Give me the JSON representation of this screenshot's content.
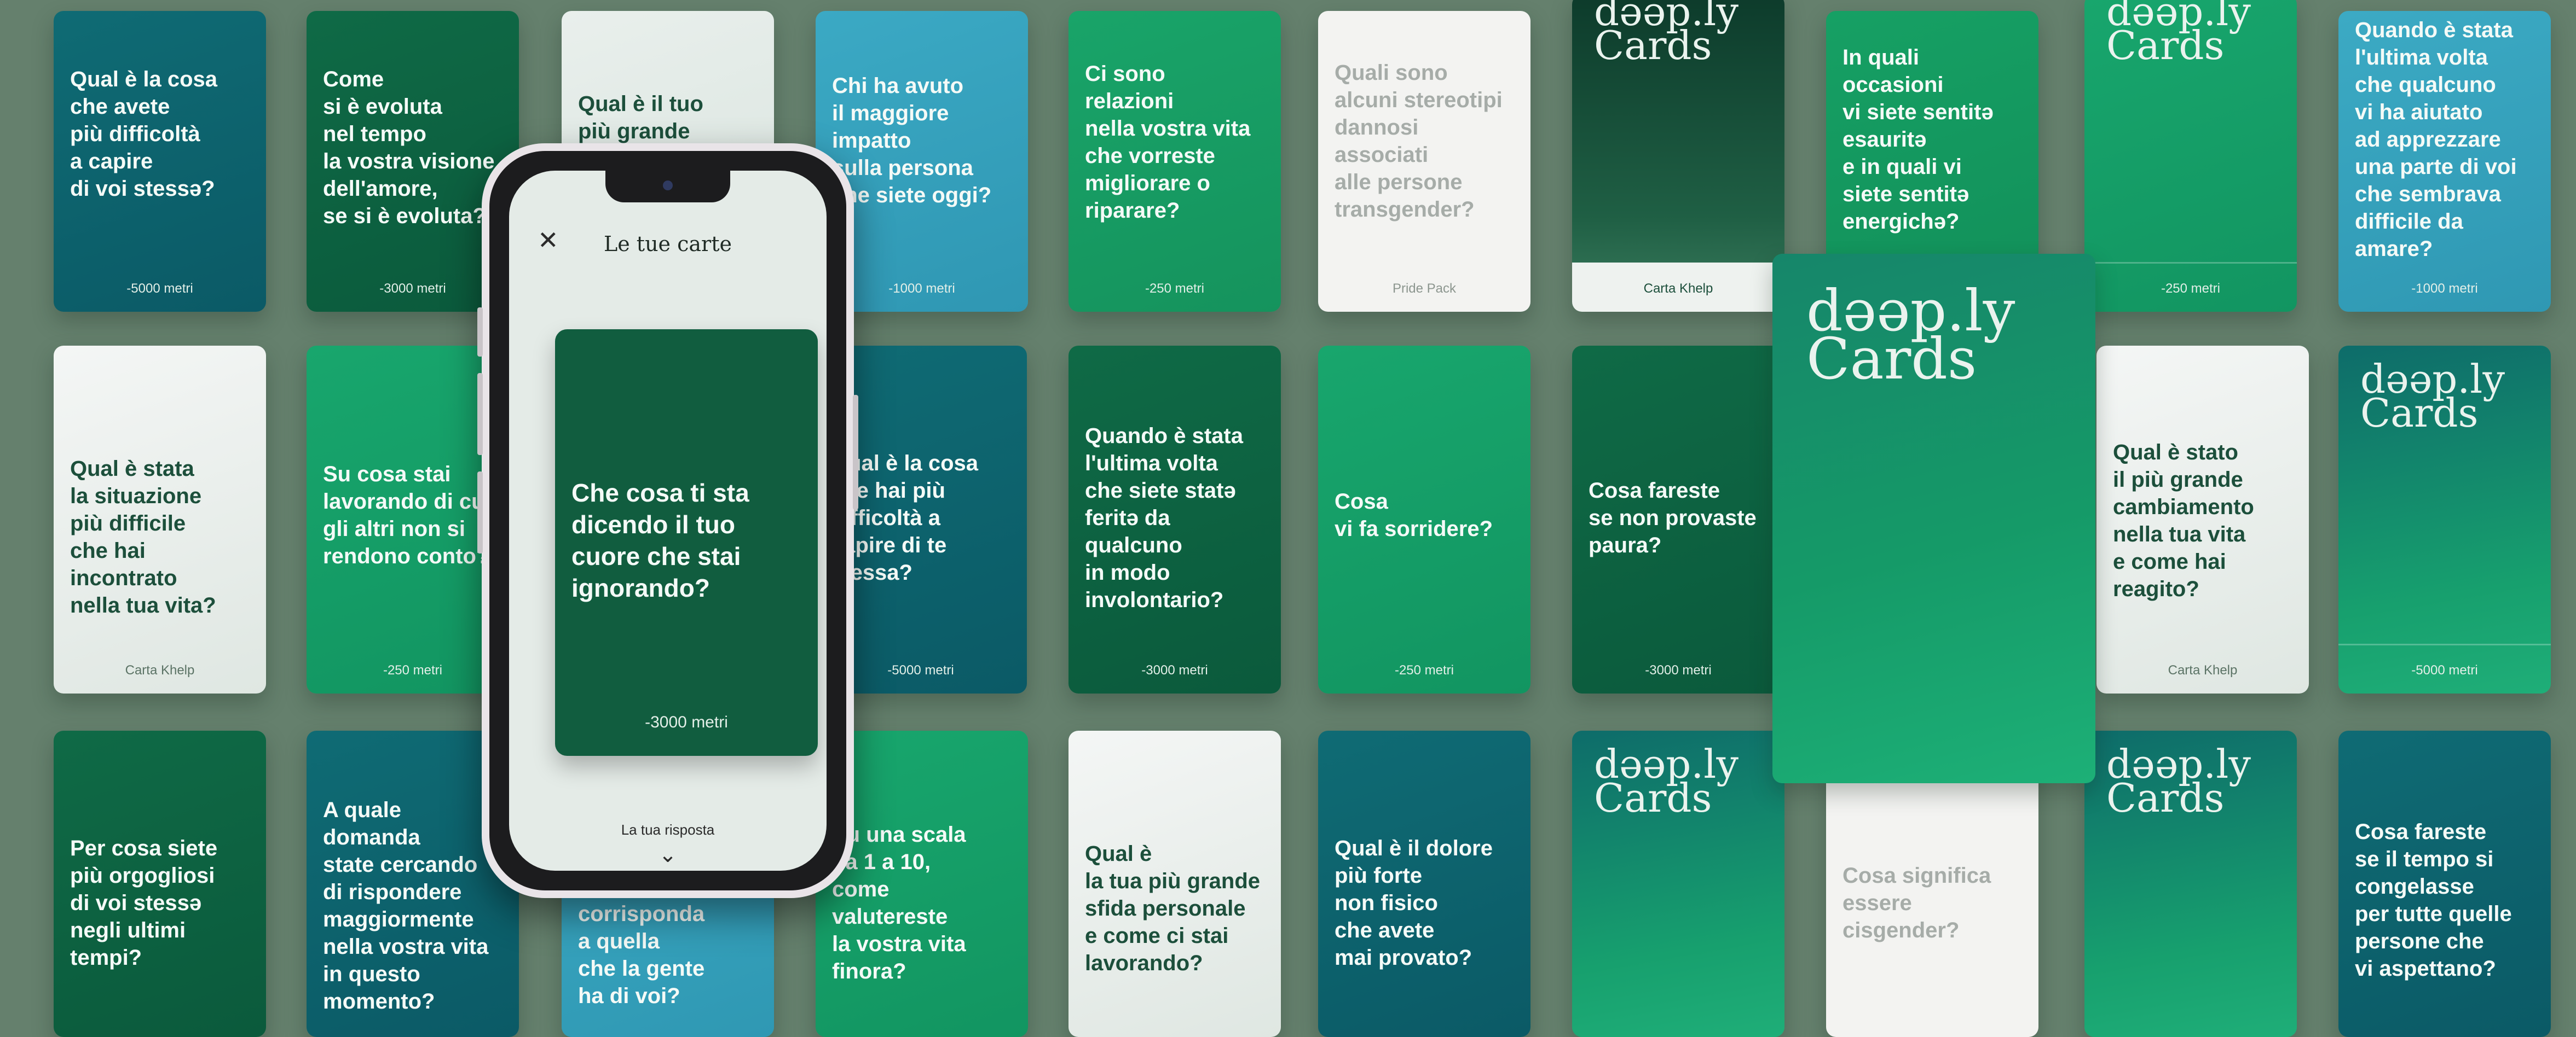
{
  "phone_screen": {
    "title": "Le tue carte",
    "close_icon": "close-icon",
    "card_question": "Che cosa ti sta\ndicendo il tuo\ncuore che stai\nignorando?",
    "card_depth": "-3000 metri",
    "answer_label": "La tua risposta",
    "expand_icon": "chevron-down-icon"
  },
  "cards": [
    {
      "theme": "dark",
      "bg": "linear-gradient(160deg,#0f6b74,#0b5a66)",
      "q": "Qual è la cosa\nche avete\npiù difficoltà\na capire\ndi voi stessə?",
      "footer": "-5000 metri"
    },
    {
      "theme": "dark",
      "bg": "linear-gradient(160deg,#0f6a46,#0b5a3c)",
      "q": "Come\nsi è evoluta\nnel tempo\nla vostra visione\ndell'amore,\nse si è evoluta?",
      "footer": "-3000 metri"
    },
    {
      "theme": "light",
      "bg": "linear-gradient(160deg,#e9efec,#d8e4de)",
      "q": "Qual è il tuo\npiù grande timore",
      "footer": ""
    },
    {
      "theme": "dark",
      "bg": "linear-gradient(160deg,#3ba9c4,#2f97b3)",
      "q": "Chi ha avuto\nil maggiore\nimpatto\nsulla persona\nche siete oggi?",
      "footer": "-1000 metri"
    },
    {
      "theme": "dark",
      "bg": "linear-gradient(160deg,#19a469,#15935d)",
      "q": "Ci sono\nrelazioni\nnella vostra vita\nche vorreste\nmigliorare o\nriparare?",
      "footer": "-250 metri"
    },
    {
      "theme": "white",
      "bg": "#f3f3f1",
      "q": "Quali sono\nalcuni stereotipi\ndannosi\nassociati\nalle persone\ntransgender?",
      "footer": "Pride Pack"
    },
    {
      "theme": "dark",
      "bg": "linear-gradient(180deg,#0d3b2b,#1f5f44 70%,#3a7b5d)",
      "q": "",
      "brand": "dəəp.ly\nCards",
      "footer": "Carta Khelp",
      "footer_light": true
    },
    {
      "theme": "dark",
      "bg": "linear-gradient(160deg,#16a064,#12905a)",
      "q": "In quali\noccasioni\nvi siete sentitə\nesauritə\ne in quali vi\nsiete sentitə\nenergichə?",
      "footer": ""
    },
    {
      "theme": "dark",
      "bg": "linear-gradient(160deg,#18a66d,#129561)",
      "q": "",
      "brand": "dəəp.ly\nCards",
      "footer": "-250 metri"
    },
    {
      "theme": "dark",
      "bg": "linear-gradient(160deg,#3caac4,#2f98b3)",
      "q": "Quando è stata\nl'ultima volta\nche qualcuno\nvi ha aiutato\nad apprezzare\nuna parte di voi\nche sembrava\ndifficile da\namare?",
      "footer": "-1000 metri"
    },
    {
      "theme": "light",
      "bg": "linear-gradient(160deg,#f4f6f5,#dfe7e2)",
      "q": "Qual è stata\nla situazione\npiù difficile\nche hai incontrato\nnella tua vita?",
      "footer": "Carta Khelp"
    },
    {
      "theme": "dark",
      "bg": "linear-gradient(160deg,#18a66d,#129561)",
      "q": "Su cosa stai\nlavorando di cui\ngli altri non si\nrendono conto?",
      "footer": "-250 metri"
    },
    {
      "theme": "dark",
      "bg": "linear-gradient(160deg,#0f6b74,#0b5a66)",
      "q": "Qual è la cosa\nche hai più\ndifficoltà a\ncapire di te\nstessa?",
      "footer": "-5000 metri"
    },
    {
      "theme": "dark",
      "bg": "linear-gradient(160deg,#0f6a46,#0b5a3c)",
      "q": "Quando è stata\nl'ultima volta\nche siete statə\nferitə da\nqualcuno\nin modo\ninvolontario?",
      "footer": "-3000 metri"
    },
    {
      "theme": "dark",
      "bg": "linear-gradient(160deg,#18a66d,#129561)",
      "q": "Cosa\nvi fa sorridere?",
      "footer": "-250 metri"
    },
    {
      "theme": "dark",
      "bg": "linear-gradient(160deg,#0f6a46,#0b5a3c)",
      "q": "Cosa fareste\nse non provaste\npaura?",
      "footer": "-3000 metri"
    },
    {
      "theme": "light",
      "bg": "linear-gradient(160deg,#f4f6f5,#dfe7e2)",
      "q": "Qual è stato\nil più grande\ncambiamento\nnella tua vita\ne come hai\nreagito?",
      "footer": "Carta Khelp"
    },
    {
      "theme": "dark",
      "bg": "linear-gradient(170deg,#0e6c6a,#17a06e 70%,#1fae78)",
      "q": "",
      "brand": "dəəp.ly\nCards",
      "footer": "-5000 metri"
    },
    {
      "theme": "dark",
      "bg": "linear-gradient(160deg,#0f6a46,#0b5a3c)",
      "q": "Per cosa siete\npiù orgogliosi\ndi voi stessə\nnegli ultimi\ntempi?",
      "footer": ""
    },
    {
      "theme": "dark",
      "bg": "linear-gradient(160deg,#0f6b74,#0b5a66)",
      "q": "A quale\ndomanda\nstate cercando\ndi rispondere\nmaggiormente\nnella vostra vita\nin questo\nmomento?",
      "footer": ""
    },
    {
      "theme": "dark",
      "bg": "linear-gradient(160deg,#3caac4,#2f98b3)",
      "q": "corrisponda\na quella\nche la gente\nha di voi?",
      "footer": ""
    },
    {
      "theme": "dark",
      "bg": "linear-gradient(160deg,#18a66d,#129561)",
      "q": "Su una scala\nda 1 a 10,\ncome\nvalutereste\nla vostra vita\nfinora?",
      "footer": ""
    },
    {
      "theme": "light",
      "bg": "linear-gradient(160deg,#f4f6f5,#dfe7e2)",
      "q": "Qual è\nla tua più grande\nsfida personale\ne come ci stai\nlavorando?",
      "footer": ""
    },
    {
      "theme": "dark",
      "bg": "linear-gradient(160deg,#0f6b74,#0b5a66)",
      "q": "Qual è il dolore\npiù forte\nnon fisico\nche avete\nmai provato?",
      "footer": ""
    },
    {
      "theme": "dark",
      "bg": "linear-gradient(170deg,#0e6c6a,#17a06e 70%,#1fae78)",
      "q": "",
      "brand": "dəəp.ly\nCards",
      "footer": ""
    },
    {
      "theme": "white",
      "bg": "#f3f3f1",
      "q": "Cosa significa\nessere\ncisgender?",
      "footer": ""
    },
    {
      "theme": "dark",
      "bg": "linear-gradient(170deg,#0e6c6a,#17a06e 70%,#1fae78)",
      "q": "",
      "brand": "dəəp.ly\nCards",
      "footer": ""
    },
    {
      "theme": "dark",
      "bg": "linear-gradient(160deg,#0f6b74,#0b5a66)",
      "q": "Cosa fareste\nse il tempo si\ncongelasse\nper tutte quelle\npersone che\nvi aspettano?",
      "footer": ""
    },
    {
      "theme": "dark",
      "bg": "linear-gradient(165deg,#16866a,#159a68 55%,#1db077)",
      "q": "",
      "brand": "dəəp.ly\nCards",
      "footer": ""
    }
  ]
}
